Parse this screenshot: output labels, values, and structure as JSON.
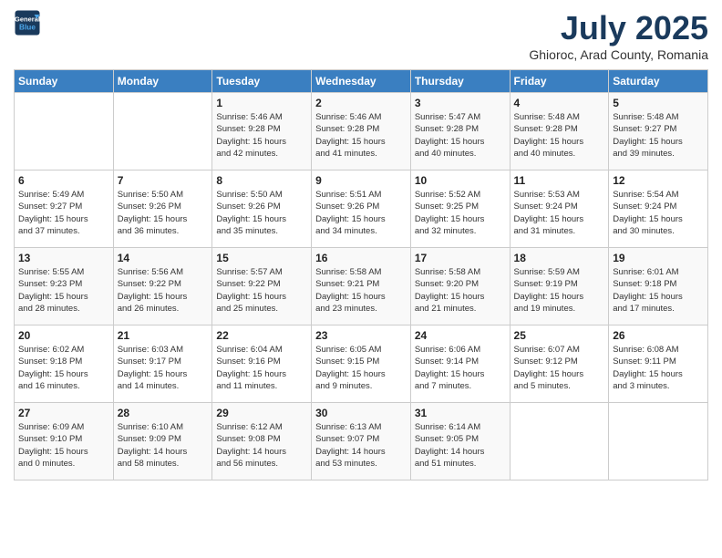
{
  "header": {
    "logo_line1": "General",
    "logo_line2": "Blue",
    "month": "July 2025",
    "location": "Ghioroc, Arad County, Romania"
  },
  "weekdays": [
    "Sunday",
    "Monday",
    "Tuesday",
    "Wednesday",
    "Thursday",
    "Friday",
    "Saturday"
  ],
  "weeks": [
    [
      {
        "day": "",
        "info": ""
      },
      {
        "day": "",
        "info": ""
      },
      {
        "day": "1",
        "info": "Sunrise: 5:46 AM\nSunset: 9:28 PM\nDaylight: 15 hours\nand 42 minutes."
      },
      {
        "day": "2",
        "info": "Sunrise: 5:46 AM\nSunset: 9:28 PM\nDaylight: 15 hours\nand 41 minutes."
      },
      {
        "day": "3",
        "info": "Sunrise: 5:47 AM\nSunset: 9:28 PM\nDaylight: 15 hours\nand 40 minutes."
      },
      {
        "day": "4",
        "info": "Sunrise: 5:48 AM\nSunset: 9:28 PM\nDaylight: 15 hours\nand 40 minutes."
      },
      {
        "day": "5",
        "info": "Sunrise: 5:48 AM\nSunset: 9:27 PM\nDaylight: 15 hours\nand 39 minutes."
      }
    ],
    [
      {
        "day": "6",
        "info": "Sunrise: 5:49 AM\nSunset: 9:27 PM\nDaylight: 15 hours\nand 37 minutes."
      },
      {
        "day": "7",
        "info": "Sunrise: 5:50 AM\nSunset: 9:26 PM\nDaylight: 15 hours\nand 36 minutes."
      },
      {
        "day": "8",
        "info": "Sunrise: 5:50 AM\nSunset: 9:26 PM\nDaylight: 15 hours\nand 35 minutes."
      },
      {
        "day": "9",
        "info": "Sunrise: 5:51 AM\nSunset: 9:26 PM\nDaylight: 15 hours\nand 34 minutes."
      },
      {
        "day": "10",
        "info": "Sunrise: 5:52 AM\nSunset: 9:25 PM\nDaylight: 15 hours\nand 32 minutes."
      },
      {
        "day": "11",
        "info": "Sunrise: 5:53 AM\nSunset: 9:24 PM\nDaylight: 15 hours\nand 31 minutes."
      },
      {
        "day": "12",
        "info": "Sunrise: 5:54 AM\nSunset: 9:24 PM\nDaylight: 15 hours\nand 30 minutes."
      }
    ],
    [
      {
        "day": "13",
        "info": "Sunrise: 5:55 AM\nSunset: 9:23 PM\nDaylight: 15 hours\nand 28 minutes."
      },
      {
        "day": "14",
        "info": "Sunrise: 5:56 AM\nSunset: 9:22 PM\nDaylight: 15 hours\nand 26 minutes."
      },
      {
        "day": "15",
        "info": "Sunrise: 5:57 AM\nSunset: 9:22 PM\nDaylight: 15 hours\nand 25 minutes."
      },
      {
        "day": "16",
        "info": "Sunrise: 5:58 AM\nSunset: 9:21 PM\nDaylight: 15 hours\nand 23 minutes."
      },
      {
        "day": "17",
        "info": "Sunrise: 5:58 AM\nSunset: 9:20 PM\nDaylight: 15 hours\nand 21 minutes."
      },
      {
        "day": "18",
        "info": "Sunrise: 5:59 AM\nSunset: 9:19 PM\nDaylight: 15 hours\nand 19 minutes."
      },
      {
        "day": "19",
        "info": "Sunrise: 6:01 AM\nSunset: 9:18 PM\nDaylight: 15 hours\nand 17 minutes."
      }
    ],
    [
      {
        "day": "20",
        "info": "Sunrise: 6:02 AM\nSunset: 9:18 PM\nDaylight: 15 hours\nand 16 minutes."
      },
      {
        "day": "21",
        "info": "Sunrise: 6:03 AM\nSunset: 9:17 PM\nDaylight: 15 hours\nand 14 minutes."
      },
      {
        "day": "22",
        "info": "Sunrise: 6:04 AM\nSunset: 9:16 PM\nDaylight: 15 hours\nand 11 minutes."
      },
      {
        "day": "23",
        "info": "Sunrise: 6:05 AM\nSunset: 9:15 PM\nDaylight: 15 hours\nand 9 minutes."
      },
      {
        "day": "24",
        "info": "Sunrise: 6:06 AM\nSunset: 9:14 PM\nDaylight: 15 hours\nand 7 minutes."
      },
      {
        "day": "25",
        "info": "Sunrise: 6:07 AM\nSunset: 9:12 PM\nDaylight: 15 hours\nand 5 minutes."
      },
      {
        "day": "26",
        "info": "Sunrise: 6:08 AM\nSunset: 9:11 PM\nDaylight: 15 hours\nand 3 minutes."
      }
    ],
    [
      {
        "day": "27",
        "info": "Sunrise: 6:09 AM\nSunset: 9:10 PM\nDaylight: 15 hours\nand 0 minutes."
      },
      {
        "day": "28",
        "info": "Sunrise: 6:10 AM\nSunset: 9:09 PM\nDaylight: 14 hours\nand 58 minutes."
      },
      {
        "day": "29",
        "info": "Sunrise: 6:12 AM\nSunset: 9:08 PM\nDaylight: 14 hours\nand 56 minutes."
      },
      {
        "day": "30",
        "info": "Sunrise: 6:13 AM\nSunset: 9:07 PM\nDaylight: 14 hours\nand 53 minutes."
      },
      {
        "day": "31",
        "info": "Sunrise: 6:14 AM\nSunset: 9:05 PM\nDaylight: 14 hours\nand 51 minutes."
      },
      {
        "day": "",
        "info": ""
      },
      {
        "day": "",
        "info": ""
      }
    ]
  ]
}
